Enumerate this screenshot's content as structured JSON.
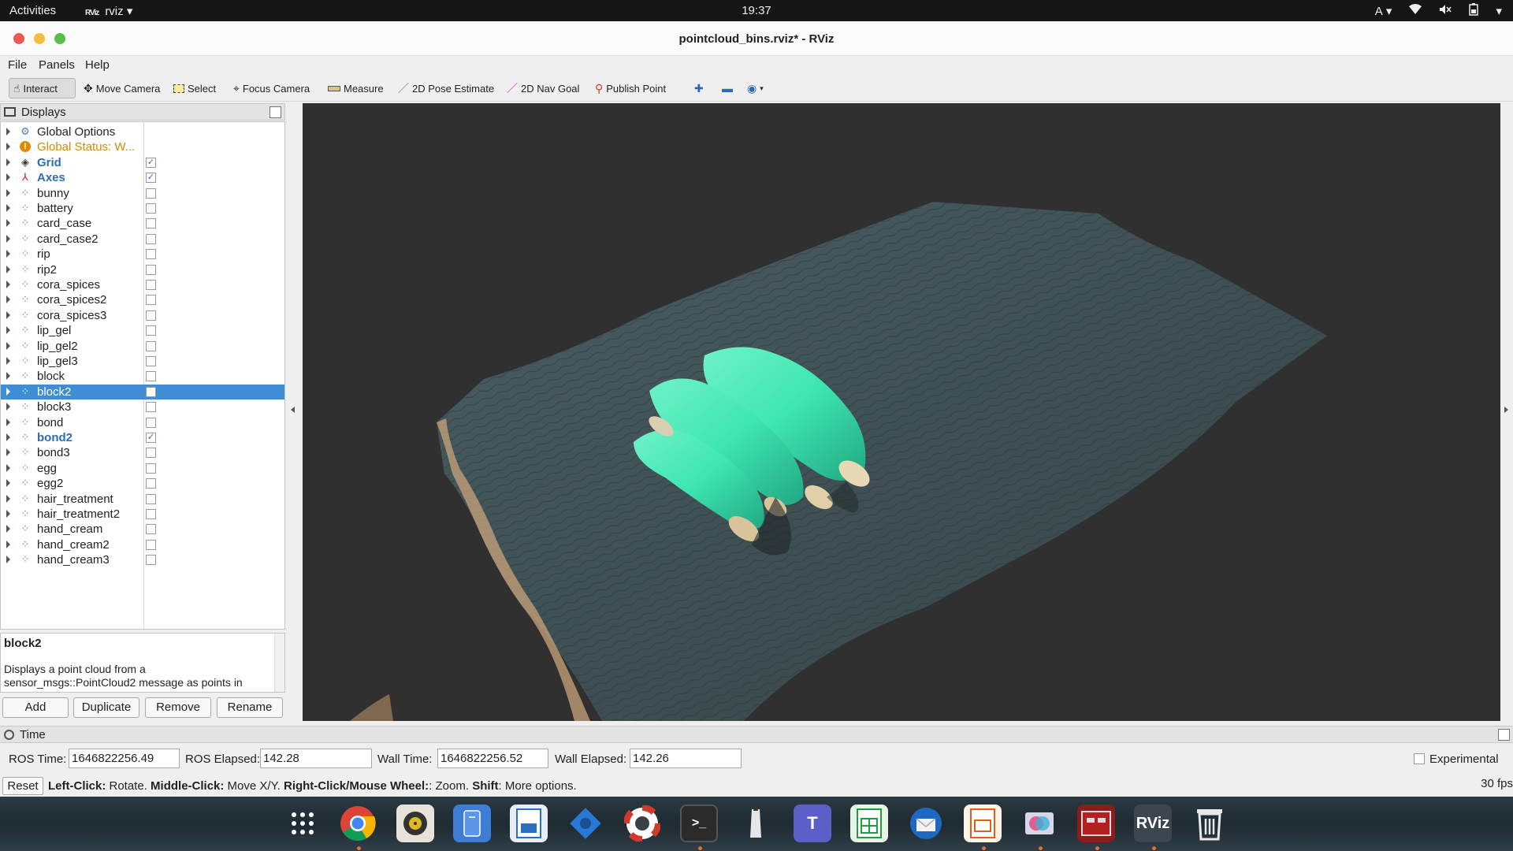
{
  "topbar": {
    "activities": "Activities",
    "app_name": "rviz",
    "app_logo": "RViz",
    "clock": "19:37",
    "input_method": "A"
  },
  "window": {
    "title": "pointcloud_bins.rviz* - RViz"
  },
  "menu": {
    "file": "File",
    "panels": "Panels",
    "help": "Help"
  },
  "toolbar": {
    "interact": "Interact",
    "move_camera": "Move Camera",
    "select": "Select",
    "focus_camera": "Focus Camera",
    "measure": "Measure",
    "pose_estimate": "2D Pose Estimate",
    "nav_goal": "2D Nav Goal",
    "publish_point": "Publish Point"
  },
  "displays": {
    "header": "Displays",
    "items": [
      {
        "label": "Global Options",
        "icon": "gear-icon",
        "style": "normal",
        "checked": null
      },
      {
        "label": "Global Status: W...",
        "icon": "warning-icon",
        "style": "warn",
        "checked": null
      },
      {
        "label": "Grid",
        "icon": "grid-icon",
        "style": "bold",
        "checked": true
      },
      {
        "label": "Axes",
        "icon": "axes-icon",
        "style": "bold",
        "checked": true
      },
      {
        "label": "bunny",
        "icon": "pointcloud-icon",
        "style": "normal",
        "checked": false
      },
      {
        "label": "battery",
        "icon": "pointcloud-icon",
        "style": "normal",
        "checked": false
      },
      {
        "label": "card_case",
        "icon": "pointcloud-icon",
        "style": "normal",
        "checked": false
      },
      {
        "label": "card_case2",
        "icon": "pointcloud-icon",
        "style": "normal",
        "checked": false
      },
      {
        "label": "rip",
        "icon": "pointcloud-icon",
        "style": "normal",
        "checked": false
      },
      {
        "label": "rip2",
        "icon": "pointcloud-icon",
        "style": "normal",
        "checked": false
      },
      {
        "label": "cora_spices",
        "icon": "pointcloud-icon",
        "style": "normal",
        "checked": false
      },
      {
        "label": "cora_spices2",
        "icon": "pointcloud-icon",
        "style": "normal",
        "checked": false
      },
      {
        "label": "cora_spices3",
        "icon": "pointcloud-icon",
        "style": "normal",
        "checked": false
      },
      {
        "label": "lip_gel",
        "icon": "pointcloud-icon",
        "style": "normal",
        "checked": false
      },
      {
        "label": "lip_gel2",
        "icon": "pointcloud-icon",
        "style": "normal",
        "checked": false
      },
      {
        "label": "lip_gel3",
        "icon": "pointcloud-icon",
        "style": "normal",
        "checked": false
      },
      {
        "label": "block",
        "icon": "pointcloud-icon",
        "style": "normal",
        "checked": false
      },
      {
        "label": "block2",
        "icon": "pointcloud-icon",
        "style": "normal",
        "checked": false,
        "selected": true
      },
      {
        "label": "block3",
        "icon": "pointcloud-icon",
        "style": "normal",
        "checked": false
      },
      {
        "label": "bond",
        "icon": "pointcloud-icon",
        "style": "normal",
        "checked": false
      },
      {
        "label": "bond2",
        "icon": "pointcloud-icon",
        "style": "bold",
        "checked": true
      },
      {
        "label": "bond3",
        "icon": "pointcloud-icon",
        "style": "normal",
        "checked": false
      },
      {
        "label": "egg",
        "icon": "pointcloud-icon",
        "style": "normal",
        "checked": false
      },
      {
        "label": "egg2",
        "icon": "pointcloud-icon",
        "style": "normal",
        "checked": false
      },
      {
        "label": "hair_treatment",
        "icon": "pointcloud-icon",
        "style": "normal",
        "checked": false
      },
      {
        "label": "hair_treatment2",
        "icon": "pointcloud-icon",
        "style": "normal",
        "checked": false
      },
      {
        "label": "hand_cream",
        "icon": "pointcloud-icon",
        "style": "normal",
        "checked": false
      },
      {
        "label": "hand_cream2",
        "icon": "pointcloud-icon",
        "style": "normal",
        "checked": false
      },
      {
        "label": "hand_cream3",
        "icon": "pointcloud-icon",
        "style": "normal",
        "checked": false
      }
    ],
    "description_title": "block2",
    "description_text": "Displays a point cloud from a sensor_msgs::PointCloud2 message as points in",
    "buttons": {
      "add": "Add",
      "duplicate": "Duplicate",
      "remove": "Remove",
      "rename": "Rename"
    }
  },
  "time": {
    "header": "Time",
    "ros_time_label": "ROS Time:",
    "ros_time": "1646822256.49",
    "ros_elapsed_label": "ROS Elapsed:",
    "ros_elapsed": "142.28",
    "wall_time_label": "Wall Time:",
    "wall_time": "1646822256.52",
    "wall_elapsed_label": "Wall Elapsed:",
    "wall_elapsed": "142.26",
    "experimental": "Experimental"
  },
  "status": {
    "reset": "Reset",
    "help_b1": "Left-Click:",
    "help_t1": " Rotate. ",
    "help_b2": "Middle-Click:",
    "help_t2": " Move X/Y. ",
    "help_b3": "Right-Click/Mouse Wheel:",
    "help_t3": ": Zoom. ",
    "help_b4": "Shift",
    "help_t4": ": More options.",
    "fps": "30 fps"
  },
  "dock": {
    "rviz_label": "RViz"
  },
  "colors": {
    "selection": "#3d8ed4",
    "viewport_bg": "#303030",
    "cloud_surface": "#3f5256",
    "object": "#3ee6b0"
  }
}
